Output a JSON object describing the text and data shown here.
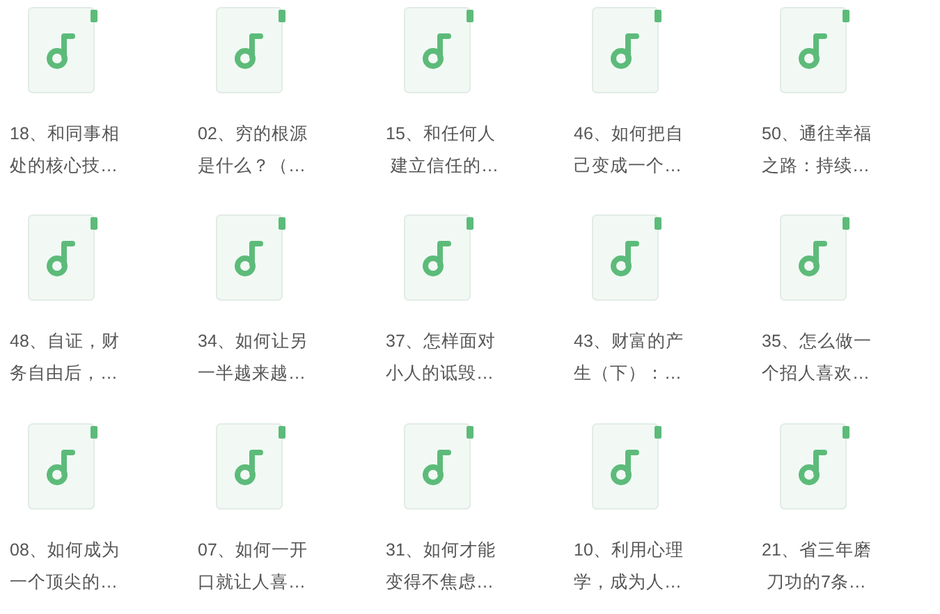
{
  "files": [
    {
      "lines": [
        "18、和同事相",
        "处的核心技…"
      ]
    },
    {
      "lines": [
        "02、穷的根源",
        "是什么？（…"
      ]
    },
    {
      "lines": [
        "15、和任何人",
        " 建立信任的…"
      ]
    },
    {
      "lines": [
        "46、如何把自",
        "己变成一个…"
      ]
    },
    {
      "lines": [
        "50、通往幸福",
        "之路：持续…"
      ]
    },
    {
      "lines": [
        "48、自证，财",
        "务自由后，…"
      ]
    },
    {
      "lines": [
        "34、如何让另",
        "一半越来越…"
      ]
    },
    {
      "lines": [
        "37、怎样面对",
        "小人的诋毁…"
      ]
    },
    {
      "lines": [
        "43、财富的产",
        "生（下）：…"
      ]
    },
    {
      "lines": [
        "35、怎么做一",
        "个招人喜欢…"
      ]
    },
    {
      "lines": [
        "08、如何成为",
        "一个顶尖的…"
      ]
    },
    {
      "lines": [
        "07、如何一开",
        "口就让人喜…"
      ]
    },
    {
      "lines": [
        "31、如何才能",
        "变得不焦虑…"
      ]
    },
    {
      "lines": [
        "10、利用心理",
        "学，成为人…"
      ]
    },
    {
      "lines": [
        "21、省三年磨",
        " 刀功的7条…"
      ]
    }
  ]
}
